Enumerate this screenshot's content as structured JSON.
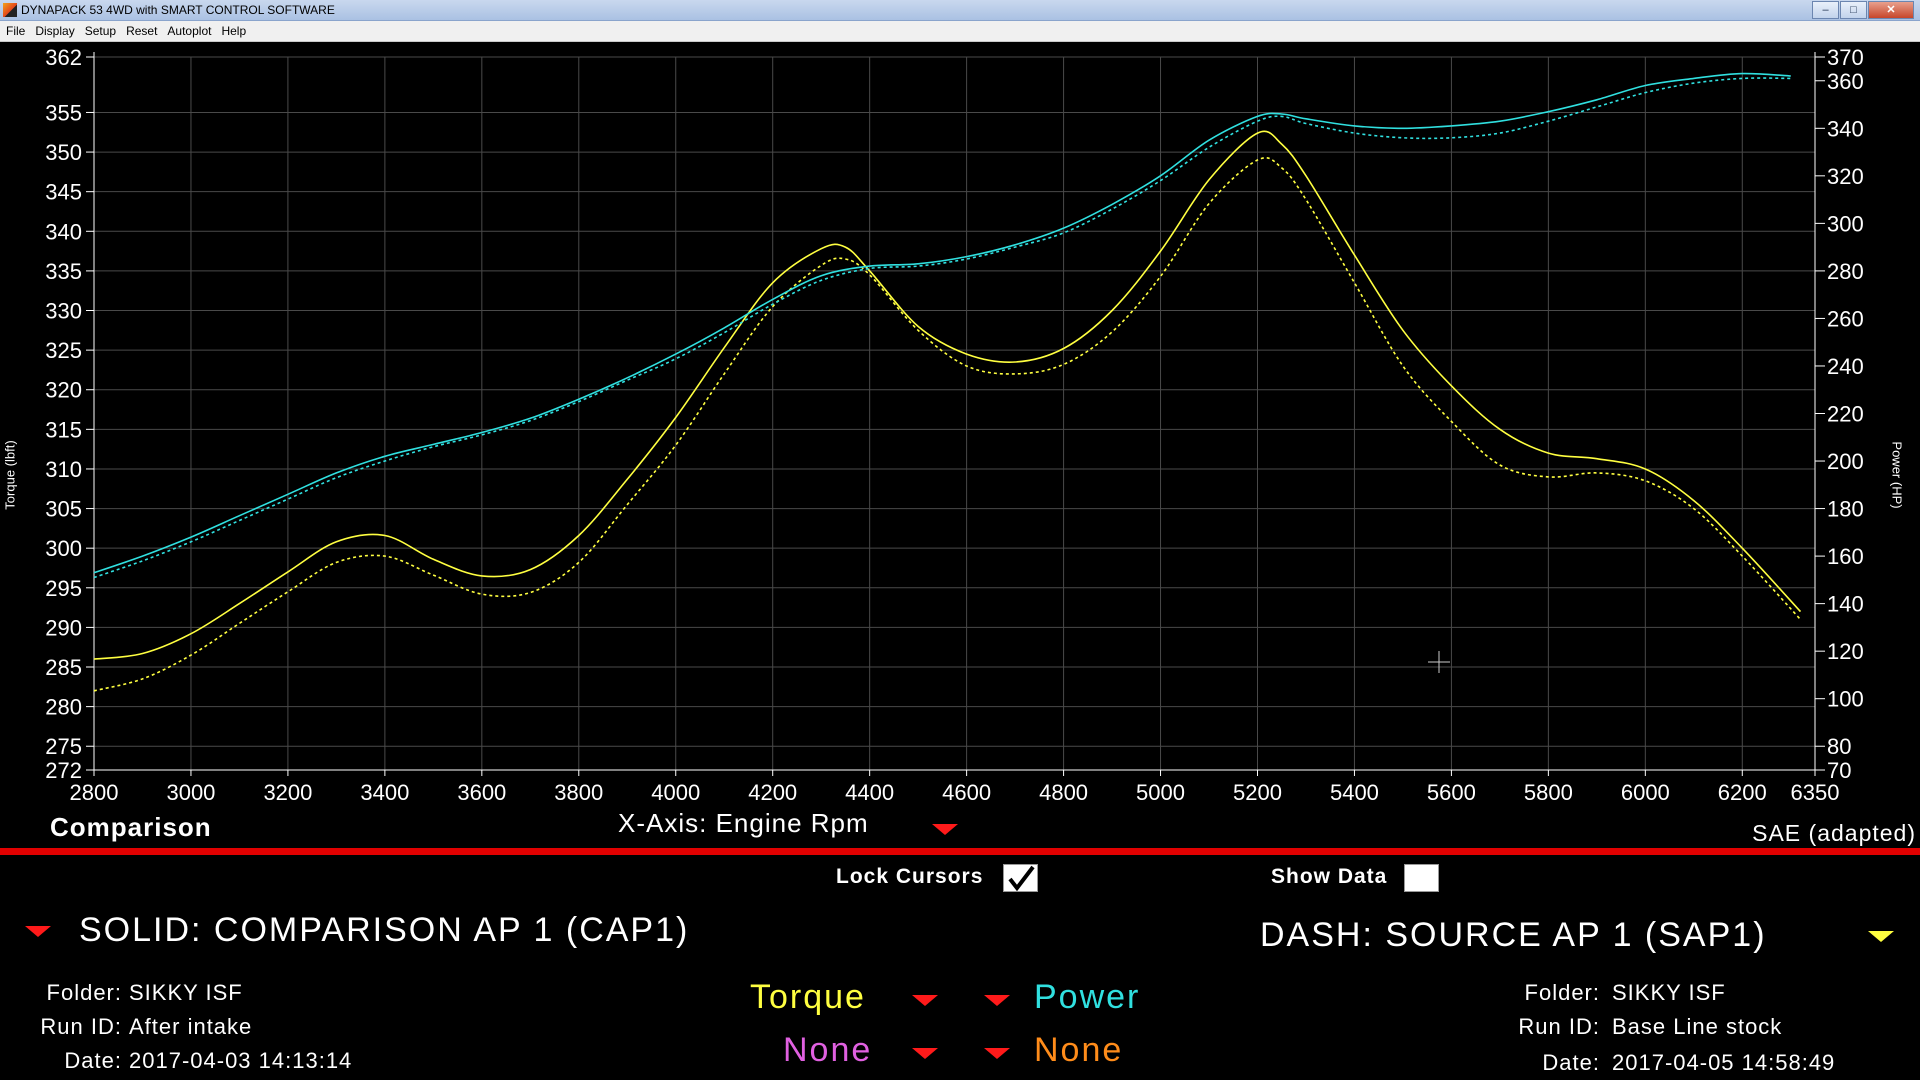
{
  "window": {
    "title": "DYNAPACK 53 4WD with SMART CONTROL SOFTWARE",
    "minimize": "–",
    "maximize": "□",
    "close": "✕"
  },
  "menu": [
    "File",
    "Display",
    "Setup",
    "Reset",
    "Autoplot",
    "Help"
  ],
  "chart_data": {
    "type": "line",
    "x_label": "X-Axis: Engine Rpm",
    "y_left_label": "Torque (lbft)",
    "y_right_label": "Power (HP)",
    "xlim": [
      2800,
      6350
    ],
    "ylim_left": [
      272,
      362
    ],
    "ylim_right": [
      70,
      370
    ],
    "x_ticks": [
      2800,
      3000,
      3200,
      3400,
      3600,
      3800,
      4000,
      4200,
      4400,
      4600,
      4800,
      5000,
      5200,
      5400,
      5600,
      5800,
      6000,
      6200,
      6350
    ],
    "y_left_ticks": [
      272,
      275,
      280,
      285,
      290,
      295,
      300,
      305,
      310,
      315,
      320,
      325,
      330,
      335,
      340,
      345,
      350,
      355,
      362
    ],
    "y_right_ticks": [
      70,
      80,
      100,
      120,
      140,
      160,
      180,
      200,
      220,
      240,
      260,
      280,
      300,
      320,
      340,
      360,
      370
    ],
    "grid": true,
    "series": [
      {
        "name": "Torque",
        "axis": "left",
        "style": "solid",
        "color": "#ffff40",
        "x": [
          2800,
          2900,
          3000,
          3100,
          3200,
          3300,
          3400,
          3500,
          3600,
          3700,
          3800,
          3900,
          4000,
          4100,
          4200,
          4300,
          4350,
          4400,
          4500,
          4600,
          4700,
          4800,
          4900,
          5000,
          5100,
          5200,
          5250,
          5300,
          5400,
          5500,
          5600,
          5700,
          5800,
          5900,
          6000,
          6100,
          6200,
          6320
        ],
        "values": [
          286,
          286.7,
          289.2,
          293,
          297,
          300.8,
          301.6,
          298.6,
          296.5,
          297.3,
          301.6,
          308.7,
          316.5,
          325.3,
          333.5,
          337.8,
          338,
          335,
          328,
          324.5,
          323.5,
          325.2,
          330,
          337.5,
          346.5,
          352.4,
          351,
          347,
          337,
          327.5,
          320.5,
          315,
          312,
          311.3,
          310,
          306,
          300,
          292
        ]
      },
      {
        "name": "Torque",
        "axis": "left",
        "style": "dash",
        "color": "#ffff40",
        "x": [
          2800,
          2900,
          3000,
          3100,
          3200,
          3300,
          3400,
          3500,
          3600,
          3700,
          3800,
          3900,
          4000,
          4100,
          4200,
          4300,
          4350,
          4400,
          4500,
          4600,
          4700,
          4800,
          4900,
          5000,
          5100,
          5200,
          5250,
          5300,
          5400,
          5500,
          5600,
          5700,
          5800,
          5900,
          6000,
          6100,
          6200,
          6320
        ],
        "values": [
          282,
          283.5,
          286.5,
          290.5,
          294.5,
          298.2,
          299,
          296.6,
          294.2,
          294.4,
          298.2,
          305.5,
          313,
          322,
          330.5,
          335.7,
          336.5,
          334.5,
          327.5,
          323,
          322,
          323.2,
          327.3,
          334.3,
          343.5,
          349,
          348,
          344,
          333.5,
          323,
          316,
          310.5,
          309,
          309.5,
          308.5,
          305,
          299,
          291
        ]
      },
      {
        "name": "Power",
        "axis": "right",
        "style": "solid",
        "color": "#30e0e0",
        "x": [
          2800,
          2900,
          3000,
          3100,
          3200,
          3300,
          3400,
          3500,
          3600,
          3700,
          3800,
          3900,
          4000,
          4100,
          4200,
          4300,
          4400,
          4500,
          4600,
          4700,
          4800,
          4900,
          5000,
          5100,
          5200,
          5250,
          5300,
          5400,
          5500,
          5600,
          5700,
          5800,
          5900,
          6000,
          6100,
          6200,
          6300
        ],
        "values": [
          153,
          160,
          168,
          177,
          186,
          195,
          202,
          207,
          212,
          218,
          226,
          235,
          245,
          256,
          268,
          278,
          282,
          283,
          286,
          291,
          298,
          308,
          320,
          335,
          345,
          346,
          344,
          341,
          340,
          341,
          343,
          347,
          352,
          358,
          361,
          363,
          362
        ]
      },
      {
        "name": "Power",
        "axis": "right",
        "style": "dash",
        "color": "#30e0e0",
        "x": [
          2800,
          2900,
          3000,
          3100,
          3200,
          3300,
          3400,
          3500,
          3600,
          3700,
          3800,
          3900,
          4000,
          4100,
          4200,
          4300,
          4400,
          4500,
          4600,
          4700,
          4800,
          4900,
          5000,
          5100,
          5200,
          5250,
          5300,
          5400,
          5500,
          5600,
          5700,
          5800,
          5900,
          6000,
          6100,
          6200,
          6300
        ],
        "values": [
          151,
          158,
          166,
          175,
          184,
          193,
          200,
          206,
          211,
          217,
          225,
          234,
          243,
          254,
          266,
          276,
          281,
          282,
          285,
          290,
          296,
          306,
          318,
          332,
          343,
          345,
          342,
          338,
          336,
          336,
          338,
          343,
          349,
          355,
          359,
          361,
          361
        ]
      }
    ]
  },
  "labels": {
    "comparison": "Comparison",
    "xaxis": "X-Axis: Engine Rpm",
    "sae": "SAE (adapted)",
    "torque_axis_title": "Torque (lbft)",
    "power_axis_title": "Power (HP)"
  },
  "controls": {
    "lock_cursors": "Lock Cursors",
    "lock_cursors_checked": true,
    "show_data": "Show Data",
    "show_data_checked": false
  },
  "solid": {
    "label": "SOLID: COMPARISON AP 1 (CAP1)",
    "folder_key": "Folder:",
    "folder": "SIKKY ISF",
    "runid_key": "Run ID:",
    "runid": "After intake",
    "date_key": "Date:",
    "date": "2017-04-03 14:13:14"
  },
  "dash": {
    "label": "DASH: SOURCE AP 1 (SAP1)",
    "folder_key": "Folder:",
    "folder": "SIKKY ISF",
    "runid_key": "Run ID:",
    "runid": "Base Line stock",
    "date_key": "Date:",
    "date": "2017-04-05 14:58:49"
  },
  "params": {
    "p1": {
      "label": "Torque",
      "color": "#ffff40"
    },
    "p2": {
      "label": "Power",
      "color": "#30e0e0"
    },
    "p3": {
      "label": "None",
      "color": "#e060e0"
    },
    "p4": {
      "label": "None",
      "color": "#ff8c1a"
    }
  },
  "colors": {
    "grid": "#4a4a4a",
    "divider": "#e10000",
    "dropdown_red": "#ff1a1a",
    "dropdown_yellow": "#ffff40"
  }
}
